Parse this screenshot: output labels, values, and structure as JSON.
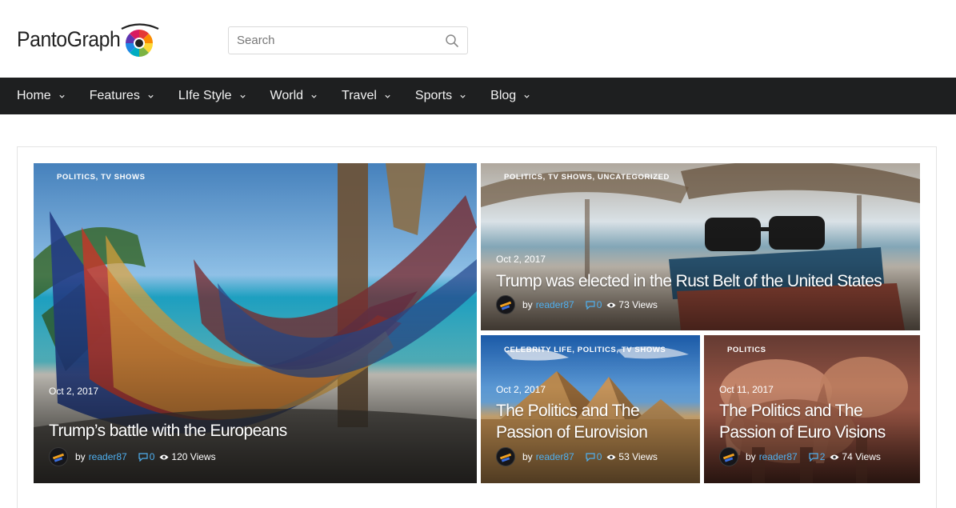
{
  "brand": {
    "name": "PantoGraph"
  },
  "search": {
    "placeholder": "Search"
  },
  "nav": {
    "items": [
      {
        "label": "Home"
      },
      {
        "label": "Features"
      },
      {
        "label": "LIfe Style"
      },
      {
        "label": "World"
      },
      {
        "label": "Travel"
      },
      {
        "label": "Sports"
      },
      {
        "label": "Blog"
      }
    ]
  },
  "posts": [
    {
      "categories": "POLITICS, TV SHOWS",
      "date": "Oct 2, 2017",
      "title": "Trump’s battle with the Europeans",
      "by": "by",
      "author": "reader87",
      "comments": "0",
      "views": "120 Views"
    },
    {
      "categories": "POLITICS, TV SHOWS, UNCATEGORIZED",
      "date": "Oct 2, 2017",
      "title": "Trump was elected in the Rust Belt of the United States",
      "by": "by",
      "author": "reader87",
      "comments": "0",
      "views": "73 Views"
    },
    {
      "categories": "CELEBRITY LIFE, POLITICS, TV SHOWS",
      "date": "Oct 2, 2017",
      "title": "The Politics and The Passion of Eurovision",
      "by": "by",
      "author": "reader87",
      "comments": "0",
      "views": "53 Views"
    },
    {
      "categories": "POLITICS",
      "date": "Oct 11, 2017",
      "title": "The Politics and The Passion of Euro Visions",
      "by": "by",
      "author": "reader87",
      "comments": "2",
      "views": "74 Views"
    }
  ],
  "colors": {
    "nav_bg": "#1e1f20",
    "accent_link": "#4fb0f0"
  },
  "icons": {
    "search": "search-icon",
    "chevron": "chevron-down-icon",
    "comment": "comment-icon",
    "views": "eye-icon"
  }
}
